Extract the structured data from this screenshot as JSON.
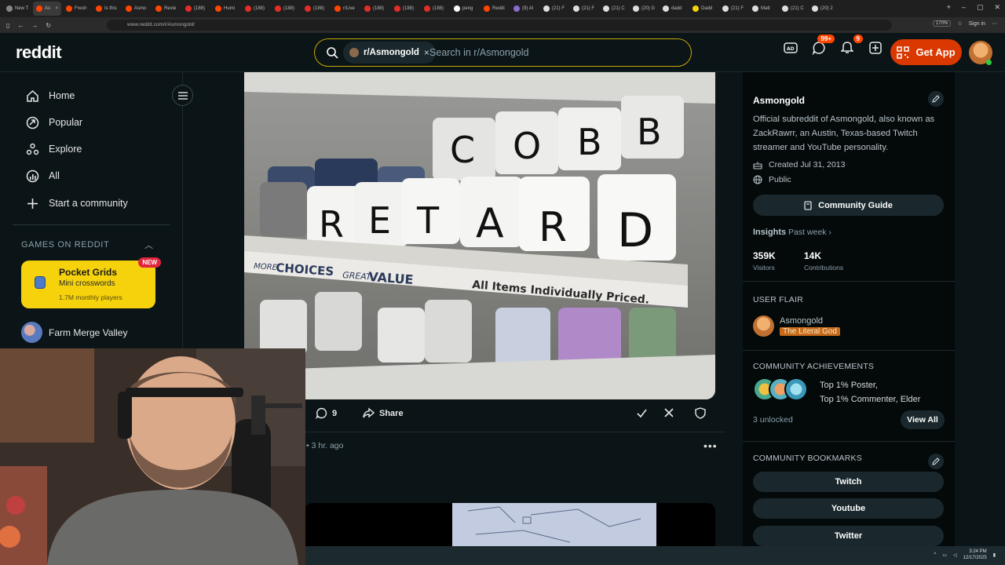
{
  "browser": {
    "tabs": [
      "New T",
      "As",
      "Fresh",
      "Is this",
      "Asmo",
      "Revie",
      "(188)",
      "Humi",
      "(188)",
      "(188)",
      "(188)",
      "r/Live",
      "(188)",
      "(188)",
      "(188)",
      "peng",
      "Reddi",
      "(9) AI",
      "(21) F",
      "(21) F",
      "(21) C",
      "(20) G",
      "dadd",
      "Dadd",
      "(21) F",
      "Matt",
      "(21) C",
      "(20) 2"
    ],
    "url": "www.reddit.com/r/Asmongold/",
    "zoom": "170%",
    "sign_in": "Sign in"
  },
  "header": {
    "logo": "reddit",
    "search_chip": "r/Asmongold",
    "search_chip_close": "×",
    "search_placeholder": "Search in r/Asmongold",
    "chat_badge": "99+",
    "notif_badge": "9",
    "get_app": "Get App"
  },
  "sidebar": {
    "items": [
      {
        "label": "Home",
        "icon": "home-icon"
      },
      {
        "label": "Popular",
        "icon": "popular-icon"
      },
      {
        "label": "Explore",
        "icon": "explore-icon"
      },
      {
        "label": "All",
        "icon": "all-icon"
      },
      {
        "label": "Start a community",
        "icon": "plus-icon"
      }
    ],
    "games_header": "GAMES ON REDDIT",
    "pocket": {
      "new": "NEW",
      "title": "Pocket Grids",
      "subtitle": "Mini crosswords",
      "players": "1.7M monthly players"
    },
    "farm": "Farm Merge Valley"
  },
  "post": {
    "image_text": {
      "mugs": [
        "R",
        "E",
        "T",
        "A",
        "R",
        "D"
      ],
      "shelf_more": "MORE",
      "shelf_choices": "CHOICES",
      "shelf_great": "GREAT",
      "shelf_value": "VALUE",
      "shelf_priced": "All Items Individually Priced."
    },
    "comments": "9",
    "share": "Share",
    "meta": "• 3 hr. ago",
    "more": "•••"
  },
  "community": {
    "name": "Asmongold",
    "description": "Official subreddit of Asmongold, also known as ZackRawrr, an Austin, Texas-based Twitch streamer and YouTube personality.",
    "created": "Created Jul 31, 2013",
    "visibility": "Public",
    "guide": "Community Guide",
    "insights": "Insights",
    "past_week": "Past week",
    "visitors_num": "359K",
    "visitors_lbl": "Visitors",
    "contrib_num": "14K",
    "contrib_lbl": "Contributions",
    "user_flair_hdr": "USER FLAIR",
    "flair_name": "Asmongold",
    "flair_tag": "The Literal God",
    "ach_hdr": "COMMUNITY ACHIEVEMENTS",
    "ach_line1": "Top 1% Poster,",
    "ach_line2": "Top 1% Commenter, Elder",
    "unlocked": "3 unlocked",
    "view_all": "View All",
    "bookmarks_hdr": "COMMUNITY BOOKMARKS",
    "bookmarks": [
      "Twitch",
      "Youtube",
      "Twitter"
    ]
  },
  "taskbar": {
    "time": "3:24 PM",
    "date": "12/17/2025"
  },
  "colors": {
    "accent": "#d93900",
    "search_border": "#c8a900",
    "badge": "#ff4500",
    "bg": "#0b1416"
  }
}
